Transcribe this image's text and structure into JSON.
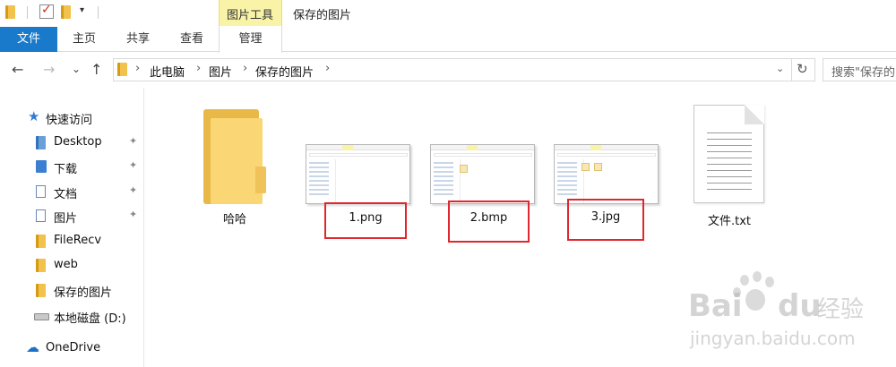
{
  "titlebar": {
    "picture_tools": "图片工具",
    "window_title": "保存的图片",
    "dropdown_glyph": "▾"
  },
  "ribbon": {
    "file": "文件",
    "home": "主页",
    "share": "共享",
    "view": "查看",
    "manage": "管理"
  },
  "nav": {
    "back": "←",
    "forward": "→",
    "recent": "⌄",
    "up": "↑",
    "sep": "›",
    "breadcrumb": [
      "此电脑",
      "图片",
      "保存的图片"
    ],
    "address_dropdown": "⌄",
    "refresh": "↻",
    "search_placeholder": "搜索\"保存的图片\""
  },
  "sidebar": {
    "items": [
      {
        "label": "快速访问",
        "icon": "star-icon"
      },
      {
        "label": "Desktop",
        "icon": "desktop-folder-icon",
        "pinned": true
      },
      {
        "label": "下载",
        "icon": "download-folder-icon",
        "pinned": true
      },
      {
        "label": "文档",
        "icon": "documents-folder-icon",
        "pinned": true
      },
      {
        "label": "图片",
        "icon": "pictures-folder-icon",
        "pinned": true
      },
      {
        "label": "FileRecv",
        "icon": "folder-icon"
      },
      {
        "label": "web",
        "icon": "folder-icon"
      },
      {
        "label": "保存的图片",
        "icon": "folder-icon"
      },
      {
        "label": "本地磁盘 (D:)",
        "icon": "drive-icon"
      },
      {
        "label": "OneDrive",
        "icon": "onedrive-icon"
      }
    ],
    "pin_glyph": "✦"
  },
  "files": [
    {
      "name": "哈哈",
      "type": "folder",
      "highlighted": false
    },
    {
      "name": "1.png",
      "type": "image",
      "highlighted": true
    },
    {
      "name": "2.bmp",
      "type": "image",
      "highlighted": true
    },
    {
      "name": "3.jpg",
      "type": "image",
      "highlighted": true
    },
    {
      "name": "文件.txt",
      "type": "text",
      "highlighted": false
    }
  ],
  "watermark": {
    "brand": "Bai",
    "brand2": "du",
    "cn": "经验",
    "url": "jingyan.baidu.com"
  },
  "colors": {
    "file_tab": "#1979ca",
    "tools_tab": "#f8f3a6",
    "highlight_border": "#e0262e",
    "folder": "#fad774"
  }
}
